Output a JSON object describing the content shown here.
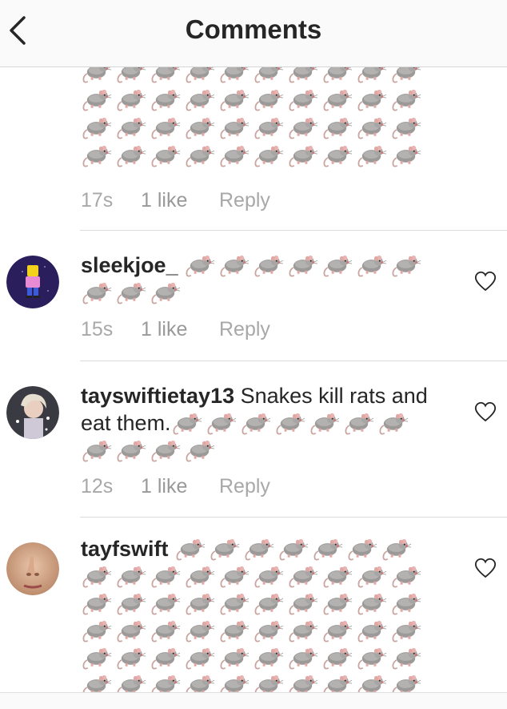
{
  "header": {
    "title": "Comments",
    "back_icon": "chevron-left-icon"
  },
  "rat_glyph": "rat-icon",
  "comments": [
    {
      "id": "c0",
      "username": "",
      "text": "",
      "rat_count": 40,
      "time": "17s",
      "likes": "1 like",
      "reply": "Reply",
      "partial_top": true
    },
    {
      "id": "c1",
      "username": "sleekjoe_",
      "text": "",
      "rat_count": 10,
      "time": "15s",
      "likes": "1 like",
      "reply": "Reply"
    },
    {
      "id": "c2",
      "username": "tayswiftietay13",
      "text": "Snakes kill rats and eat them.",
      "rat_count": 11,
      "time": "12s",
      "likes": "1 like",
      "reply": "Reply"
    },
    {
      "id": "c3",
      "username": "tayfswift",
      "text": "",
      "rat_count": 57,
      "time": "",
      "likes": "",
      "reply": ""
    }
  ],
  "colors": {
    "text": "#262626",
    "meta": "#a8a8a8",
    "divider": "#dbdbdb",
    "header_bg": "#fafafa"
  }
}
